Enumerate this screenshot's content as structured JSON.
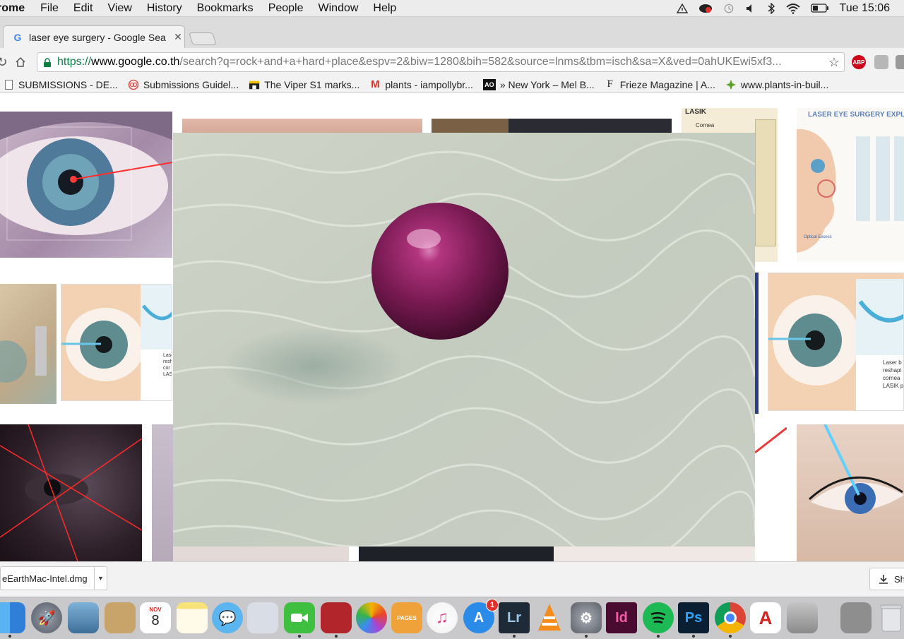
{
  "menubar": {
    "app": "rome",
    "items": [
      "File",
      "Edit",
      "View",
      "History",
      "Bookmarks",
      "People",
      "Window",
      "Help"
    ],
    "clock": "Tue 15:06"
  },
  "tab": {
    "title": "laser eye surgery - Google Sea",
    "favicon": "G"
  },
  "omnibox": {
    "scheme": "https://",
    "host": "www.google.co.th",
    "path": "/search?q=rock+and+a+hard+place&espv=2&biw=1280&bih=582&source=lnms&tbm=isch&sa=X&ved=0ahUKEwi5xf3...",
    "abp": "ABP"
  },
  "bookmarks": [
    {
      "label": "SUBMISSIONS - DE...",
      "icon": "page-icon"
    },
    {
      "label": "Submissions Guidel...",
      "icon": "ring-icon"
    },
    {
      "label": "The Viper S1 marks...",
      "icon": "shop-icon"
    },
    {
      "label": "plants - iampollybr...",
      "icon": "gmail-icon",
      "glyph": "M"
    },
    {
      "label": "» New York – Mel B...",
      "icon": "ao-icon",
      "glyph": "AO"
    },
    {
      "label": "Frieze Magazine | A...",
      "icon": "frieze-icon",
      "glyph": "F"
    },
    {
      "label": "www.plants-in-buil...",
      "icon": "leaf-icon"
    }
  ],
  "content": {
    "thumb_texts": {
      "lasik": "LASIK",
      "cornea": "Cornea",
      "explain": "LASER EYE SURGERY EXPLAI",
      "optical": "Optical Excess",
      "laser_caption": "Laser b\nreshapi\ncornea\nLASIK p",
      "laser_caption_left": "Lase\nresh\ncor\nLASI"
    }
  },
  "downloads": {
    "file": "eEarthMac-Intel.dmg",
    "show_all": "Sh"
  },
  "dock": {
    "calendar_month": "NOV",
    "calendar_day": "8",
    "appstore_badge": "1",
    "lr": "Lr",
    "id": "Id",
    "ps": "Ps",
    "pages": "PAGES"
  }
}
